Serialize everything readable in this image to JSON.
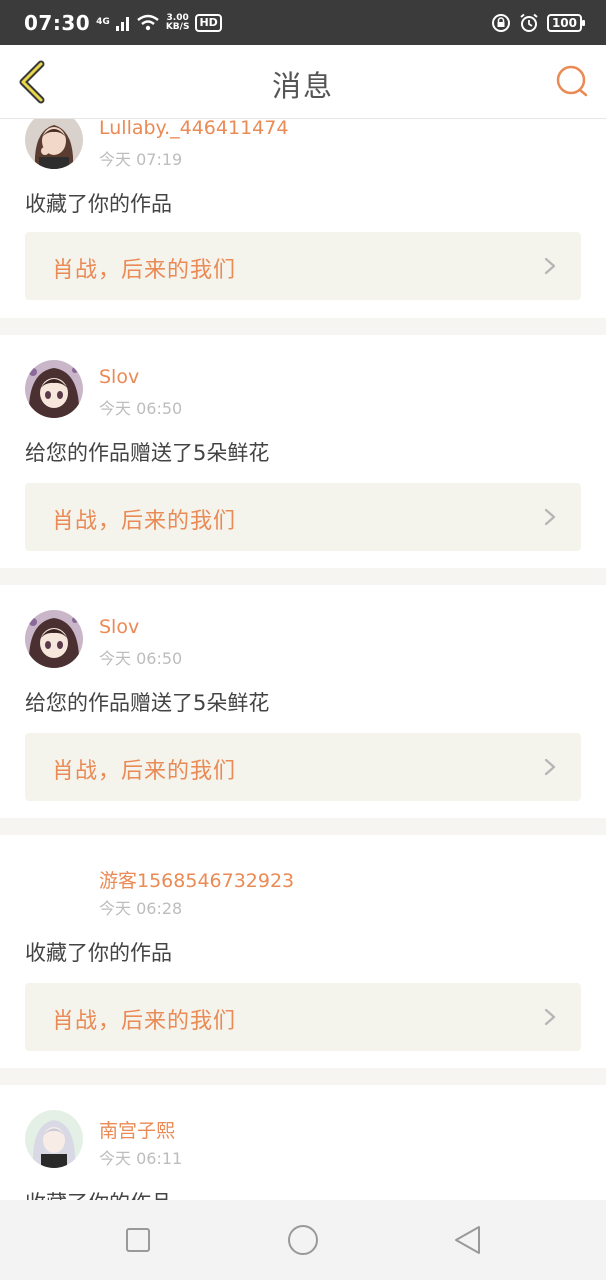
{
  "status_bar": {
    "time": "07:30",
    "network": "4G",
    "speed_value": "3.00",
    "speed_unit": "KB/S",
    "hd": "HD",
    "battery": "100"
  },
  "header": {
    "title": "消息",
    "back_icon": "chevron-left-icon",
    "search_icon": "search-icon",
    "accent_color": "#ea8a55"
  },
  "messages": [
    {
      "user": "Lullaby._446411474",
      "time": "今天 07:19",
      "action": "收藏了你的作品",
      "work_title": "肖战，后来的我们",
      "avatar": "girl-avatar"
    },
    {
      "user": "Slov",
      "time": "今天 06:50",
      "action": "给您的作品赠送了5朵鲜花",
      "work_title": "肖战，后来的我们",
      "avatar": "anime-avatar"
    },
    {
      "user": "Slov",
      "time": "今天 06:50",
      "action": "给您的作品赠送了5朵鲜花",
      "work_title": "肖战，后来的我们",
      "avatar": "anime-avatar"
    },
    {
      "user": "游客1568546732923",
      "time": "今天 06:28",
      "action": "收藏了你的作品",
      "work_title": "肖战，后来的我们",
      "avatar": ""
    },
    {
      "user": "南宫子熙",
      "time": "今天 06:11",
      "action": "收藏了你的作品",
      "work_title": "",
      "avatar": "anime-avatar"
    }
  ],
  "system_nav": {
    "recent_icon": "square-icon",
    "home_icon": "circle-icon",
    "back_icon": "triangle-back-icon"
  }
}
